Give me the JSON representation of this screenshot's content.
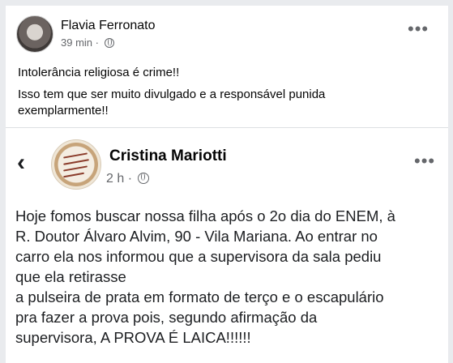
{
  "post": {
    "author": "Flavia Ferronato",
    "time": "39 min",
    "separator": "·",
    "lines": [
      "Intolerância religiosa é crime!!",
      "Isso tem que ser muito divulgado e a responsável punida",
      "exemplarmente!!"
    ]
  },
  "shared": {
    "author": "Cristina Mariotti",
    "time": "2 h",
    "separator": "·",
    "lines": [
      "Hoje fomos buscar nossa filha após o 2o dia do ENEM, à",
      "R. Doutor Álvaro Alvim, 90 - Vila Mariana. Ao entrar no",
      "carro ela nos informou que a supervisora da sala pediu",
      "que ela retirasse",
      "a pulseira de prata em formato de terço e o escapulário",
      "pra fazer a prova pois, segundo afirmação da",
      "supervisora, A PROVA É LAICA!!!!!!"
    ]
  },
  "icons": {
    "more": "more-options-icon",
    "globe": "globe-icon",
    "back": "chevron-left-icon"
  },
  "more_glyph": "•••",
  "back_glyph": "‹"
}
